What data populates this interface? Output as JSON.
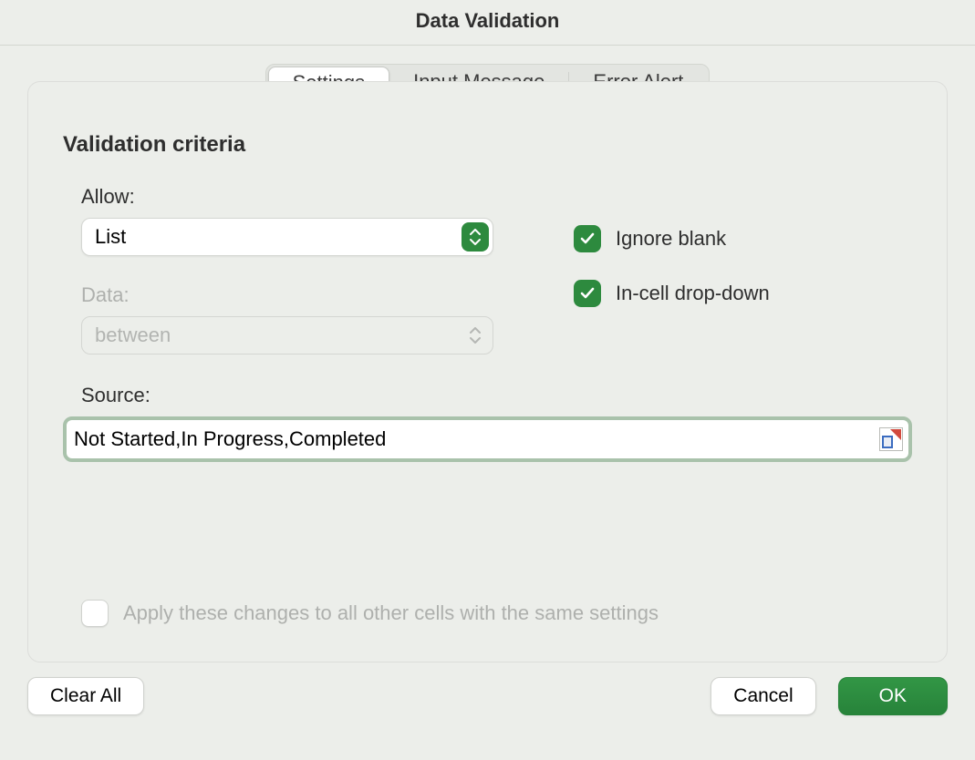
{
  "title": "Data Validation",
  "tabs": {
    "settings": "Settings",
    "input_message": "Input Message",
    "error_alert": "Error Alert"
  },
  "criteria": {
    "heading": "Validation criteria",
    "allow_label": "Allow:",
    "allow_value": "List",
    "data_label": "Data:",
    "data_value": "between",
    "source_label": "Source:",
    "source_value": "Not Started,In Progress,Completed"
  },
  "checks": {
    "ignore_blank": "Ignore blank",
    "in_cell_dropdown": "In-cell drop-down",
    "apply_all": "Apply these changes to all other cells with the same settings"
  },
  "buttons": {
    "clear_all": "Clear All",
    "cancel": "Cancel",
    "ok": "OK"
  }
}
